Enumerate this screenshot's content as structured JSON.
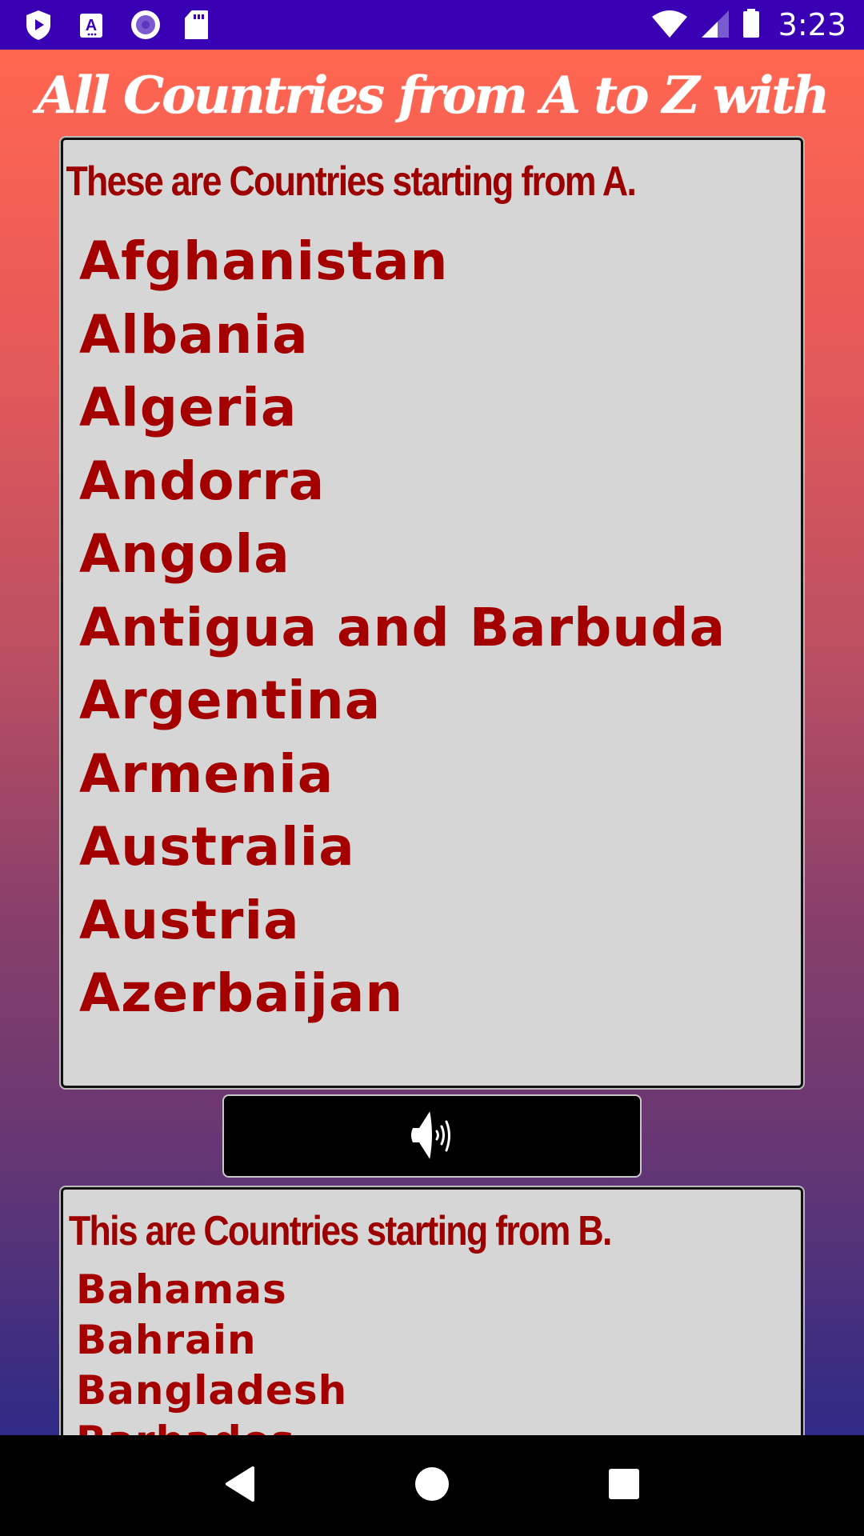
{
  "status_bar": {
    "time": "3:23",
    "left_icons": [
      "play-protect-icon",
      "accessibility-a-icon",
      "record-circle-icon",
      "sd-card-icon"
    ],
    "right_icons": [
      "wifi-icon",
      "cellular-signal-icon",
      "battery-icon"
    ]
  },
  "app": {
    "title": "All Countries from A to Z with Sound",
    "sections": [
      {
        "letter": "A",
        "heading": "These are Countries starting from A.",
        "countries": [
          "Afghanistan",
          "Albania",
          "Algeria",
          "Andorra",
          "Angola",
          "Antigua and Barbuda",
          "Argentina",
          "Armenia",
          "Australia",
          "Austria",
          "Azerbaijan"
        ]
      },
      {
        "letter": "B",
        "heading": "This are Countries starting from B.",
        "countries": [
          "Bahamas",
          "Bahrain",
          "Bangladesh",
          "Barbados"
        ]
      }
    ],
    "sound_button": {
      "icon": "speaker-volume-icon"
    }
  },
  "colors": {
    "status_bar": "#3a00b4",
    "gradient_top": "#ff6650",
    "gradient_bottom": "#2e2a86",
    "card_background": "#d6d6d6",
    "text_red": "#a40000",
    "title_text": "#ffffff"
  },
  "nav_bar": {
    "buttons": [
      "back-icon",
      "home-icon",
      "recents-icon"
    ]
  }
}
